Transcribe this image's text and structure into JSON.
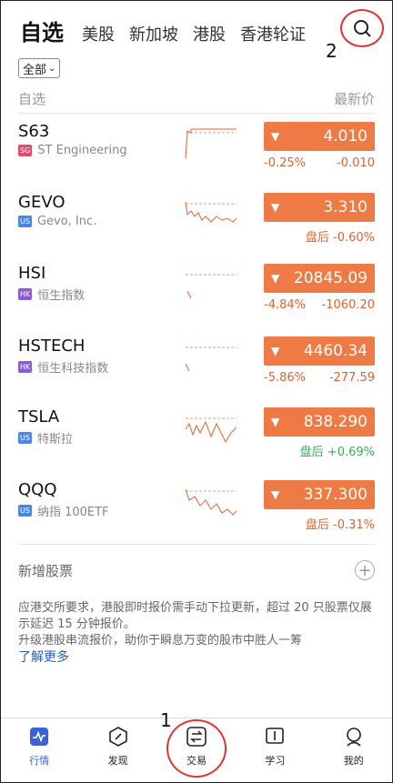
{
  "tabs": [
    "自选",
    "美股",
    "新加坡",
    "港股",
    "香港轮证"
  ],
  "markers": {
    "m1": "1",
    "m2": "2"
  },
  "filter": {
    "label": "全部"
  },
  "list_header": {
    "left": "自选",
    "right": "最新价"
  },
  "stocks": [
    {
      "symbol": "S63",
      "market": "SG",
      "market_color": "#e34b6a",
      "name": "ST Engineering",
      "price": "4.010",
      "chg1": "-0.25%",
      "chg2": "-0.010"
    },
    {
      "symbol": "GEVO",
      "market": "US",
      "market_color": "#4a86e8",
      "name": "Gevo, Inc.",
      "price": "3.310",
      "chg1": "",
      "chg2": "盘后 -0.60%"
    },
    {
      "symbol": "HSI",
      "market": "HK",
      "market_color": "#8a5bd8",
      "name": "恒生指数",
      "price": "20845.09",
      "chg1": "-4.84%",
      "chg2": "-1060.20"
    },
    {
      "symbol": "HSTECH",
      "market": "HK",
      "market_color": "#8a5bd8",
      "name": "恒生科技指数",
      "price": "4460.34",
      "chg1": "-5.86%",
      "chg2": "-277.59"
    },
    {
      "symbol": "TSLA",
      "market": "US",
      "market_color": "#4a86e8",
      "name": "特斯拉",
      "price": "838.290",
      "chg1": "",
      "chg2": "盘后 +0.69%"
    },
    {
      "symbol": "QQQ",
      "market": "US",
      "market_color": "#4a86e8",
      "name": "纳指 100ETF",
      "price": "337.300",
      "chg1": "",
      "chg2": "盘后 -0.31%"
    }
  ],
  "add_stock": {
    "label": "新增股票"
  },
  "notice": {
    "line1": "应港交所要求，港股即时报价需手动下拉更新，超过 20 只股票仅展示延迟 15 分钟报价。",
    "line2": "升级港股串流报价，助你于瞬息万变的股市中胜人一筹",
    "link": "了解更多"
  },
  "nav": [
    {
      "label": "行情",
      "icon": "market-icon"
    },
    {
      "label": "发现",
      "icon": "discover-icon"
    },
    {
      "label": "交易",
      "icon": "trade-icon"
    },
    {
      "label": "学习",
      "icon": "learn-icon"
    },
    {
      "label": "我的",
      "icon": "profile-icon"
    }
  ],
  "colors": {
    "accent": "#3862d6",
    "down": "#ee7a45",
    "up": "#2fae5a"
  }
}
